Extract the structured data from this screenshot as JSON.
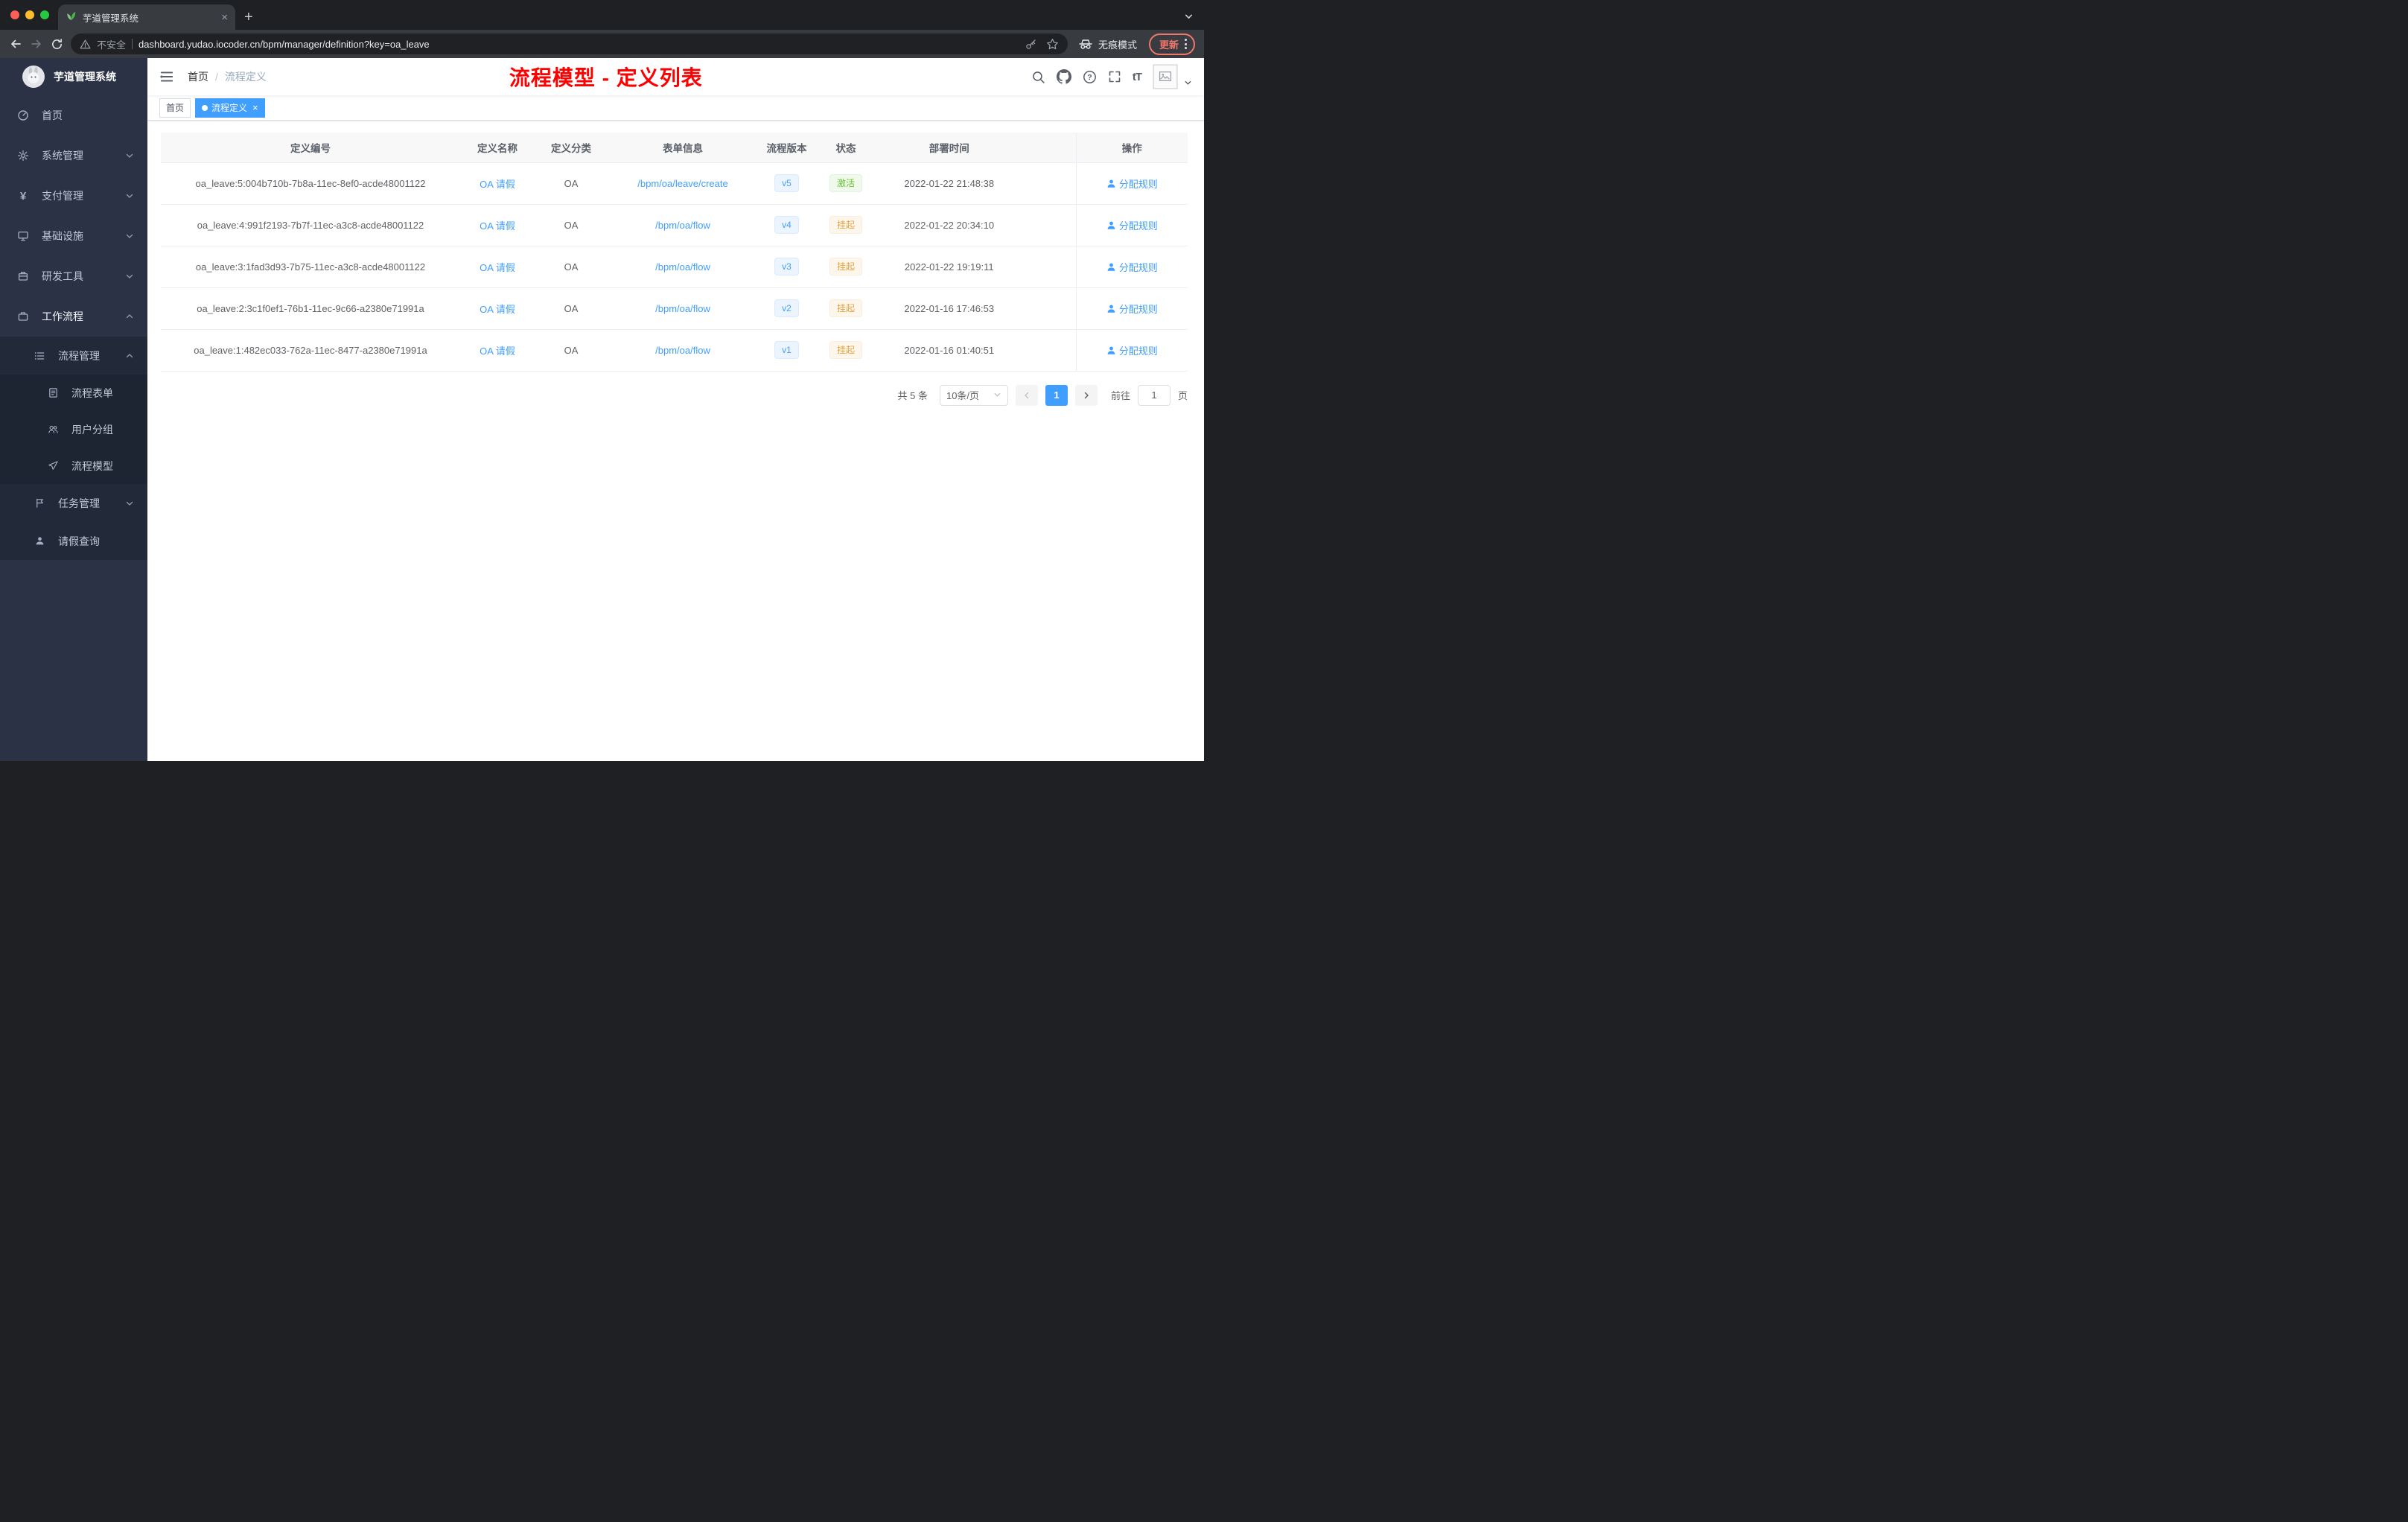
{
  "browser": {
    "tab_title": "芋道管理系统",
    "security_label": "不安全",
    "url": "dashboard.yudao.iocoder.cn/bpm/manager/definition?key=oa_leave",
    "incognito_label": "无痕模式",
    "update_label": "更新"
  },
  "sidebar": {
    "logo_title": "芋道管理系统",
    "items": [
      {
        "label": "首页"
      },
      {
        "label": "系统管理"
      },
      {
        "label": "支付管理"
      },
      {
        "label": "基础设施"
      },
      {
        "label": "研发工具"
      },
      {
        "label": "工作流程"
      },
      {
        "label": "流程管理"
      },
      {
        "label": "流程表单"
      },
      {
        "label": "用户分组"
      },
      {
        "label": "流程模型"
      },
      {
        "label": "任务管理"
      },
      {
        "label": "请假查询"
      }
    ]
  },
  "header": {
    "breadcrumb_home": "首页",
    "breadcrumb_separator": "/",
    "breadcrumb_current": "流程定义",
    "annotation": "流程模型 - 定义列表"
  },
  "tags": {
    "home": "首页",
    "current": "流程定义"
  },
  "table": {
    "columns": [
      "定义编号",
      "定义名称",
      "定义分类",
      "表单信息",
      "流程版本",
      "状态",
      "部署时间",
      "操作"
    ],
    "rows": [
      {
        "id": "oa_leave:5:004b710b-7b8a-11ec-8ef0-acde48001122",
        "name": "OA 请假",
        "category": "OA",
        "form": "/bpm/oa/leave/create",
        "version": "v5",
        "status": "激活",
        "status_type": "success",
        "deploy_time": "2022-01-22 21:48:38",
        "action": "分配规则"
      },
      {
        "id": "oa_leave:4:991f2193-7b7f-11ec-a3c8-acde48001122",
        "name": "OA 请假",
        "category": "OA",
        "form": "/bpm/oa/flow",
        "version": "v4",
        "status": "挂起",
        "status_type": "warning",
        "deploy_time": "2022-01-22 20:34:10",
        "action": "分配规则"
      },
      {
        "id": "oa_leave:3:1fad3d93-7b75-11ec-a3c8-acde48001122",
        "name": "OA 请假",
        "category": "OA",
        "form": "/bpm/oa/flow",
        "version": "v3",
        "status": "挂起",
        "status_type": "warning",
        "deploy_time": "2022-01-22 19:19:11",
        "action": "分配规则"
      },
      {
        "id": "oa_leave:2:3c1f0ef1-76b1-11ec-9c66-a2380e71991a",
        "name": "OA 请假",
        "category": "OA",
        "form": "/bpm/oa/flow",
        "version": "v2",
        "status": "挂起",
        "status_type": "warning",
        "deploy_time": "2022-01-16 17:46:53",
        "action": "分配规则"
      },
      {
        "id": "oa_leave:1:482ec033-762a-11ec-8477-a2380e71991a",
        "name": "OA 请假",
        "category": "OA",
        "form": "/bpm/oa/flow",
        "version": "v1",
        "status": "挂起",
        "status_type": "warning",
        "deploy_time": "2022-01-16 01:40:51",
        "action": "分配规则"
      }
    ]
  },
  "pagination": {
    "total": "共 5 条",
    "page_size": "10条/页",
    "current_page": "1",
    "goto_label": "前往",
    "goto_value": "1",
    "unit_label": "页"
  },
  "colors": {
    "accent": "#409eff",
    "success": "#67c23a",
    "warning": "#e6a23c",
    "annotation_red": "#fe0000",
    "sidebar_bg": "#2b3245"
  }
}
